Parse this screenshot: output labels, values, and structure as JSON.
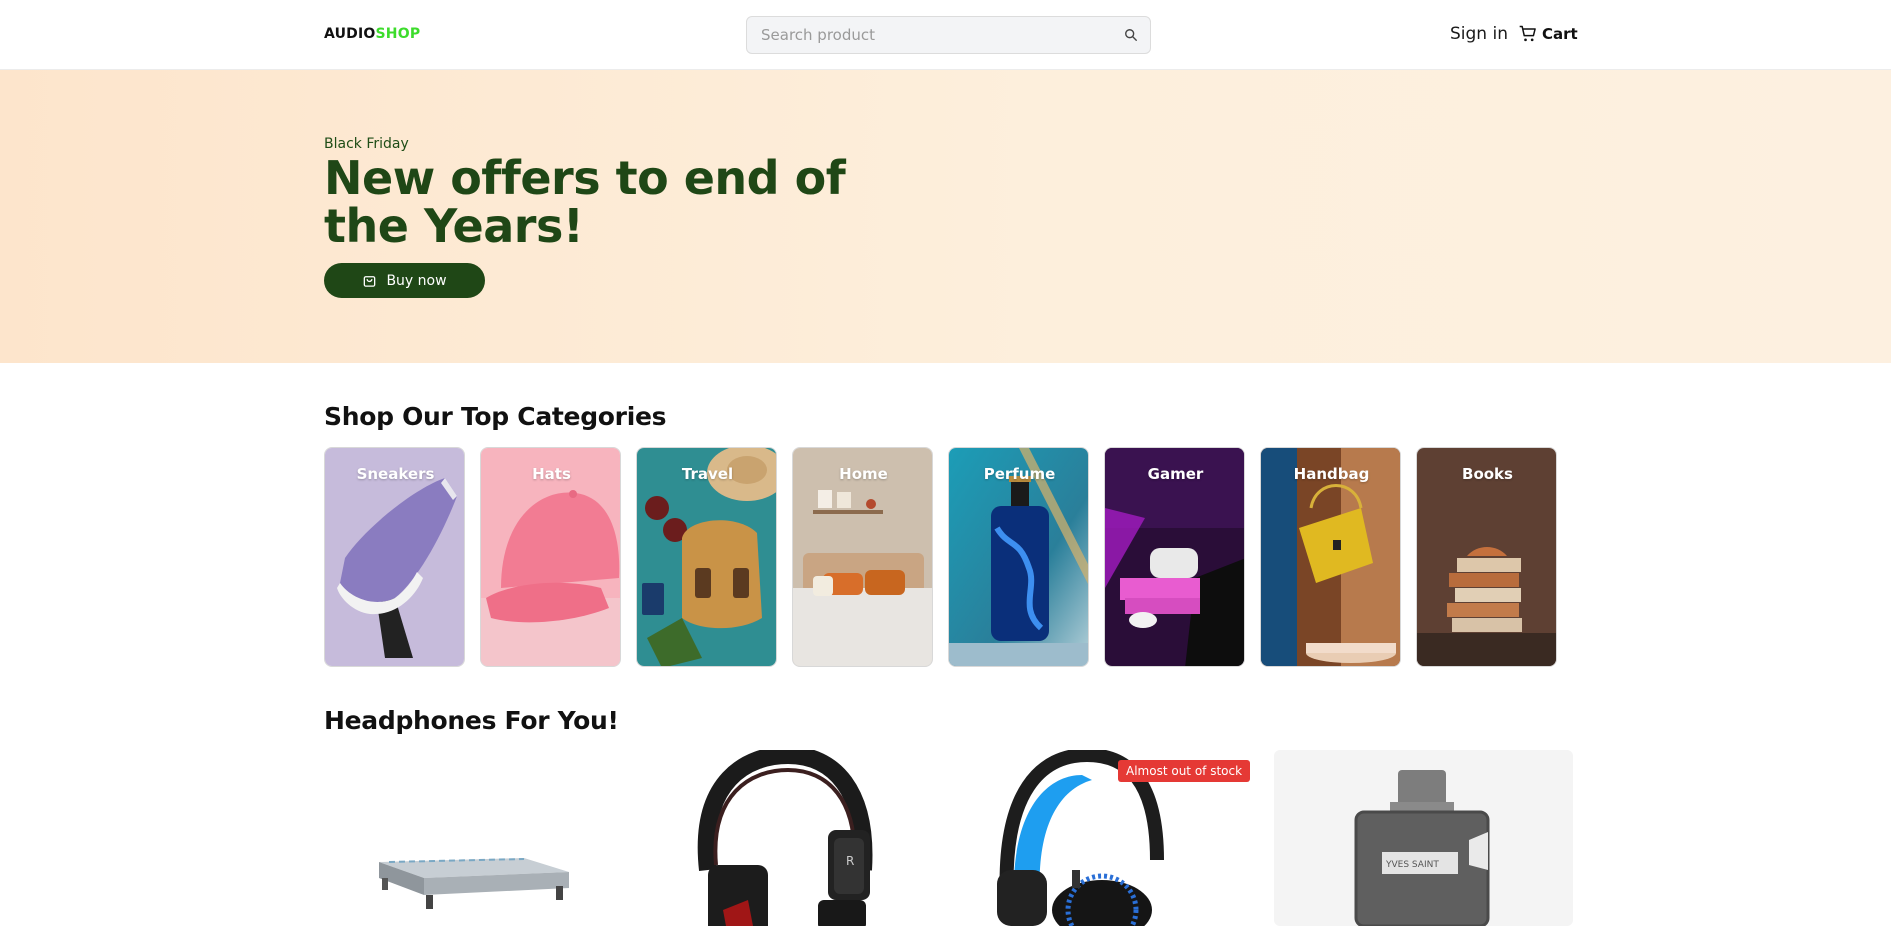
{
  "header": {
    "logo_part1": "AUDIO",
    "logo_part2": "SHOP",
    "search_placeholder": "Search product",
    "signin_label": "Sign in",
    "cart_label": "Cart"
  },
  "hero": {
    "kicker": "Black Friday",
    "headline": "New offers to end of the Years!",
    "button_label": "Buy now"
  },
  "categories_section": {
    "title": "Shop Our Top Categories",
    "items": [
      {
        "label": "Sneakers"
      },
      {
        "label": "Hats"
      },
      {
        "label": "Travel"
      },
      {
        "label": "Home"
      },
      {
        "label": "Perfume"
      },
      {
        "label": "Gamer"
      },
      {
        "label": "Handbag"
      },
      {
        "label": "Books"
      }
    ]
  },
  "products_section": {
    "title": "Headphones For You!",
    "badge": "Almost out of stock",
    "items": [
      {
        "image": "mattress"
      },
      {
        "image": "black-headphones"
      },
      {
        "image": "blue-gaming-headset"
      },
      {
        "image": "perfume-bottle"
      }
    ]
  },
  "colors": {
    "brand_dark_green": "#1f4716",
    "logo_accent": "#3ddc2c",
    "hero_bg": "#fde9d3",
    "badge_red": "#e53935"
  }
}
